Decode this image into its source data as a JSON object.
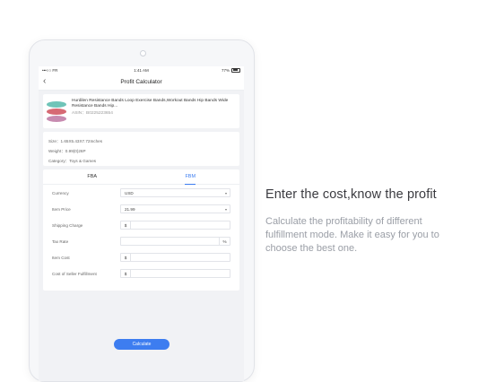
{
  "statusbar": {
    "carrier": "•••○○ FR",
    "time": "1:41 AM",
    "battery": "77%"
  },
  "navbar": {
    "back_glyph": "‹",
    "title": "Profit Calculator"
  },
  "product": {
    "title": "Hurdilen Resistance Bands Loop Exercise Bands,Workout Bands Hip Bands Wide Resistance Bands Hip...",
    "asin": "ASIN：B0225223654",
    "thumb_colors": [
      "#c78bb0",
      "#d66a74",
      "#6fc4b8"
    ]
  },
  "specs": {
    "size": "Size：1.65X5.43X7.72Inches",
    "weight": "Weight：0.99(0)26P",
    "category": "Category：Toys & Games"
  },
  "tabs": [
    {
      "label": "FBA",
      "active": false
    },
    {
      "label": "FBM",
      "active": true
    }
  ],
  "form": {
    "currency": {
      "label": "Currency",
      "value": "USD"
    },
    "item_price": {
      "label": "Item Price",
      "value": "21.99"
    },
    "shipping_charge": {
      "label": "Shipping Charge",
      "prefix": "$"
    },
    "tax_rate": {
      "label": "Tax Rate",
      "suffix": "%"
    },
    "item_cost": {
      "label": "Item Cost",
      "prefix": "$"
    },
    "fulfillment_cost": {
      "label": "Cost of Seller Fulfillment",
      "prefix": "$"
    }
  },
  "calculate_label": "Calculate",
  "promo": {
    "headline": "Enter the cost,know the profit",
    "description": "Calculate the profitability of different fulfillment mode. Make it easy for you to choose the best one."
  },
  "colors": {
    "accent": "#3d7df0",
    "background": "#f1f2f5"
  }
}
